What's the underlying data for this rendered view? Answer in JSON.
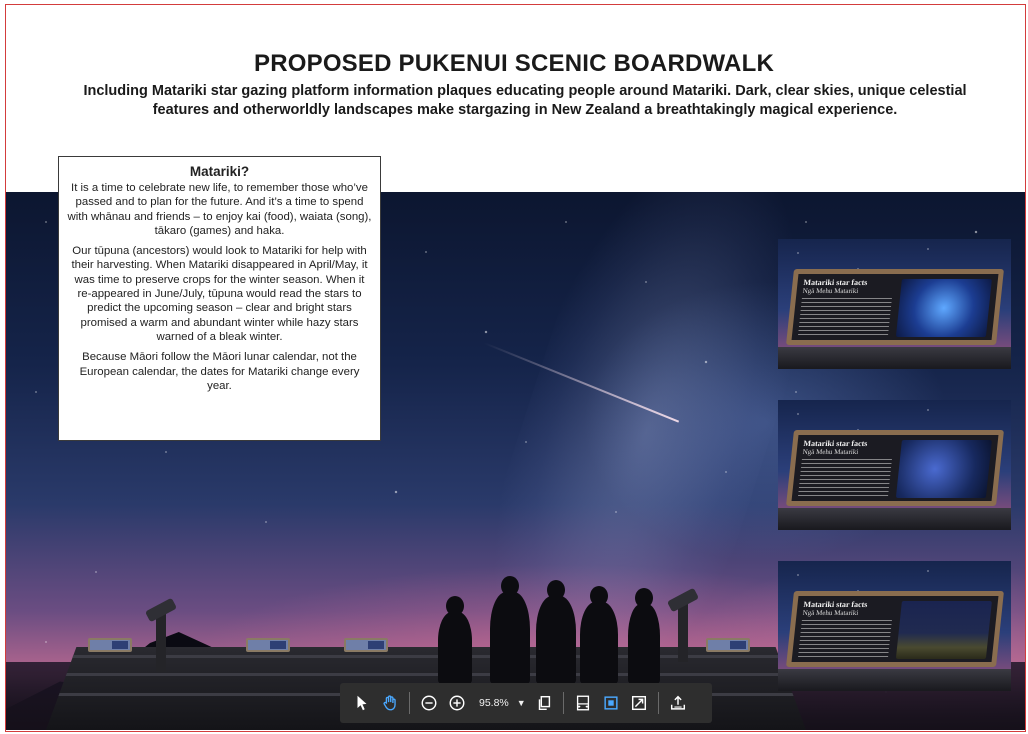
{
  "header": {
    "title": "PROPOSED PUKENUI SCENIC BOARDWALK",
    "subtitle": "Including Matariki star gazing platform information plaques educating people around Matariki. Dark, clear skies, unique celestial features and otherworldly landscapes make stargazing in New Zealand a breathtakingly magical experience."
  },
  "info_box": {
    "title": "Matariki?",
    "paragraphs": [
      "It is a time to celebrate new life, to remember those who’ve passed and to plan for the future. And it’s a time to spend with whānau and friends – to enjoy kai (food), waiata (song), tākaro (games) and haka.",
      "Our tūpuna (ancestors) would look to Matariki for help with their harvesting. When Matariki disappeared in April/May, it was time to preserve crops for the winter season. When it re-appeared in June/July, tūpuna would read the stars to predict the upcoming season – clear and bright stars promised a warm and abundant winter while hazy stars warned of a bleak winter.",
      "Because Māori follow the Māori lunar calendar, not the European calendar, the dates for Matariki change every year."
    ]
  },
  "fact_panels": [
    {
      "board_title": "Matariki star facts",
      "board_subtitle": "Ngā Mehu Matariki"
    },
    {
      "board_title": "Matariki star facts",
      "board_subtitle": "Ngā Mehu Matariki"
    },
    {
      "board_title": "Matariki star facts",
      "board_subtitle": "Ngā Mehu Matariki"
    }
  ],
  "toolbar": {
    "zoom_level": "95.8%",
    "icons": {
      "select": "cursor-arrow-icon",
      "pan": "hand-icon",
      "zoom_out": "zoom-out-icon",
      "zoom_in": "zoom-in-icon",
      "zoom_dropdown": "chevron-down-icon",
      "copy": "copy-icon",
      "fit_width": "fit-width-icon",
      "fit_page": "fit-page-icon",
      "fullscreen": "fullscreen-icon",
      "export": "export-icon"
    },
    "active_color": "#4aa8ff"
  }
}
